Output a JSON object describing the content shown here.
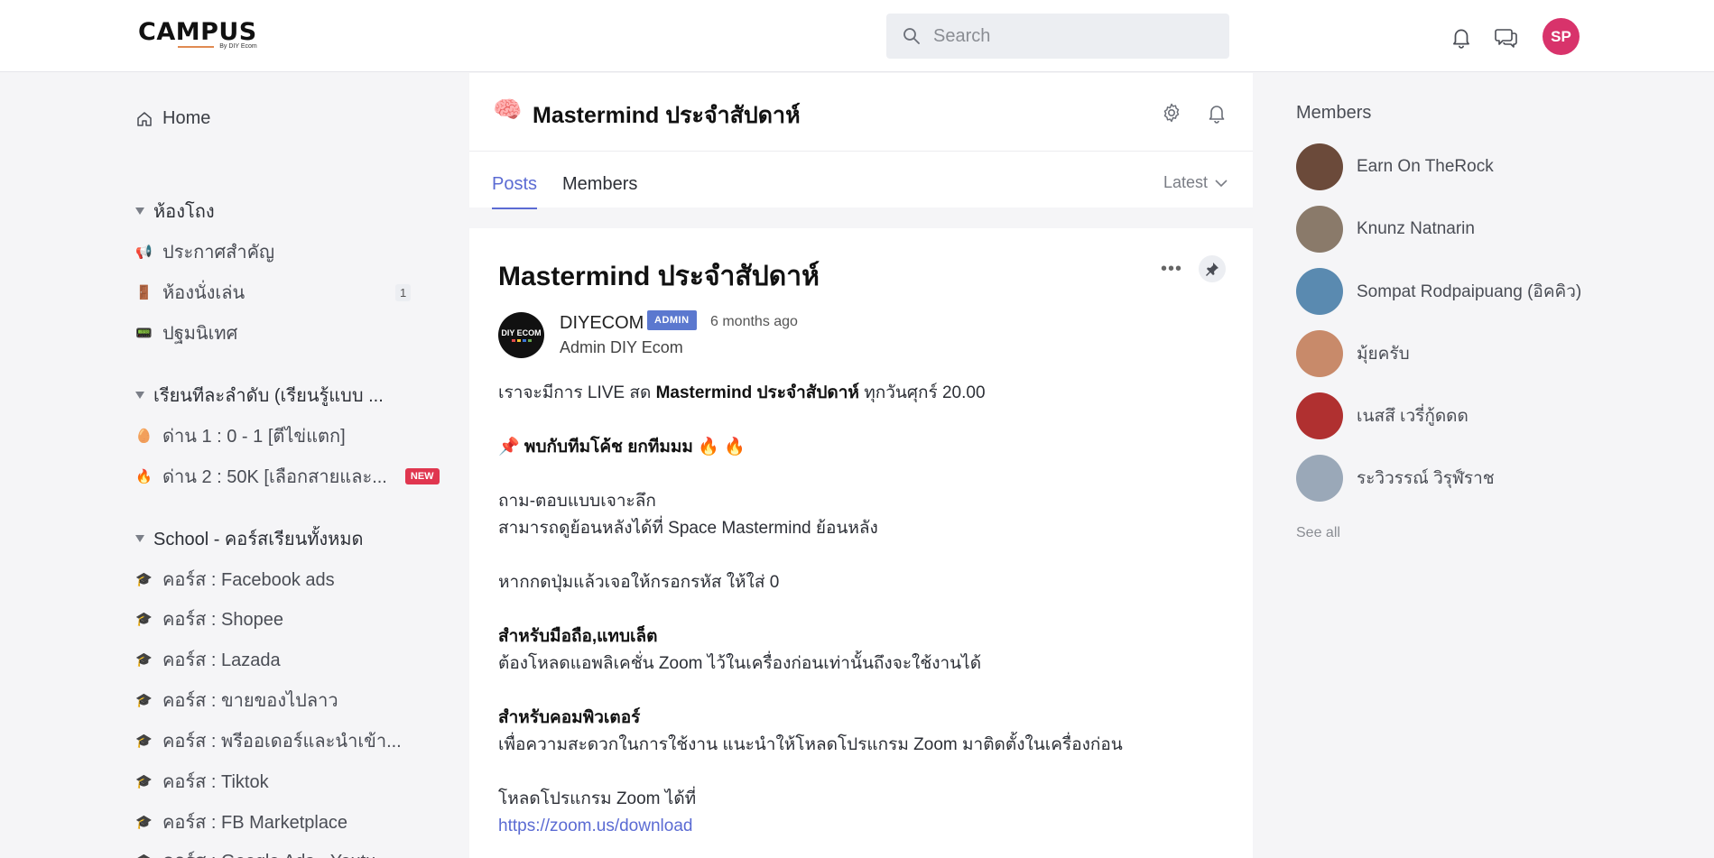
{
  "header": {
    "logo": "CAMPUS",
    "logo_sub": "By DIY Ecom",
    "search_placeholder": "Search",
    "avatar_initials": "SP"
  },
  "sidebar": {
    "home_label": "Home",
    "sections": [
      {
        "title": "ห้องโถง",
        "items": [
          {
            "icon": "megaphone-icon",
            "emoji": "📢",
            "label": "ประกาศสำคัญ",
            "count": ""
          },
          {
            "icon": "door-icon",
            "emoji": "🚪",
            "label": "ห้องนั่งเล่น",
            "count": "1"
          },
          {
            "icon": "pager-icon",
            "emoji": "📟",
            "label": "ปฐมนิเทศ",
            "count": ""
          }
        ]
      },
      {
        "title": "เรียนทีละลำดับ (เรียนรู้แบบ ...",
        "items": [
          {
            "icon": "egg-icon",
            "emoji": "🥚",
            "label": "ด่าน 1 : 0 - 1 [ตีไข่แตก]",
            "new": ""
          },
          {
            "icon": "fire-icon",
            "emoji": "🔥",
            "label": "ด่าน 2 : 50K [เลือกสายและ...",
            "new": "NEW"
          }
        ]
      },
      {
        "title": "School - คอร์สเรียนทั้งหมด",
        "items": [
          {
            "icon": "graduation-cap-icon",
            "emoji": "🎓",
            "label": "คอร์ส : Facebook ads"
          },
          {
            "icon": "graduation-cap-icon",
            "emoji": "🎓",
            "label": "คอร์ส : Shopee"
          },
          {
            "icon": "graduation-cap-icon",
            "emoji": "🎓",
            "label": "คอร์ส : Lazada"
          },
          {
            "icon": "graduation-cap-icon",
            "emoji": "🎓",
            "label": "คอร์ส : ขายของไปลาว"
          },
          {
            "icon": "graduation-cap-icon",
            "emoji": "🎓",
            "label": "คอร์ส : พรีออเดอร์และนำเข้า..."
          },
          {
            "icon": "graduation-cap-icon",
            "emoji": "🎓",
            "label": "คอร์ส : Tiktok"
          },
          {
            "icon": "graduation-cap-icon",
            "emoji": "🎓",
            "label": "คอร์ส : FB Marketplace"
          },
          {
            "icon": "graduation-cap-icon",
            "emoji": "🎓",
            "label": "คอร์ส : Google Ads - Youtu..."
          }
        ]
      }
    ]
  },
  "space": {
    "emoji": "🧠",
    "title": "Mastermind ประจำสัปดาห์",
    "tabs": [
      "Posts",
      "Members"
    ],
    "sort_label": "Latest"
  },
  "post": {
    "title": "Mastermind ประจำสัปดาห์",
    "author": "DIYECOM",
    "author_avatar_text": "DIY ECOM",
    "badge": "ADMIN",
    "time": "6 months ago",
    "author_sub": "Admin DIY Ecom",
    "line1_pre": "เราจะมีการ LIVE สด ",
    "line1_bold": "Mastermind ประจำสัปดาห์",
    "line1_post": " ทุกวันศุกร์ 20.00",
    "line2": "📌 พบกับทีมโค้ช ยกทีมมม 🔥 🔥",
    "line3": "ถาม-ตอบแบบเจาะลึก",
    "line4": "สามารถดูย้อนหลังได้ที่ Space Mastermind ย้อนหลัง",
    "line5": "หากกดปุ่มแล้วเจอให้กรอกรหัส ให้ใส่ 0",
    "line6": "สำหรับมือถือ,แทบเล็ต",
    "line7": "ต้องโหลดแอพลิเคชั่น Zoom ไว้ในเครื่องก่อนเท่านั้นถึงจะใช้งานได้",
    "line8": "สำหรับคอมพิวเตอร์",
    "line9": "เพื่อความสะดวกในการใช้งาน แนะนำให้โหลดโปรแกรม Zoom มาติดตั้งในเครื่องก่อน",
    "line10": "โหลดโปรแกรม Zoom ได้ที่",
    "link": "https://zoom.us/download"
  },
  "members_panel": {
    "title": "Members",
    "members": [
      {
        "name": "Earn On TheRock",
        "color": "#6b4a3a"
      },
      {
        "name": "Knunz Natnarin",
        "color": "#8a7a6a"
      },
      {
        "name": "Sompat Rodpaipuang (อิคคิว)",
        "color": "#5a8ab0"
      },
      {
        "name": "มุ้ยครับ",
        "color": "#c88a6a"
      },
      {
        "name": "เนสสึ เวรี่กู้ดดด",
        "color": "#b03030"
      },
      {
        "name": "ระวิวรรณ์ วิรุฬ์ราช",
        "color": "#9aa8b8"
      }
    ],
    "see_all": "See all"
  }
}
